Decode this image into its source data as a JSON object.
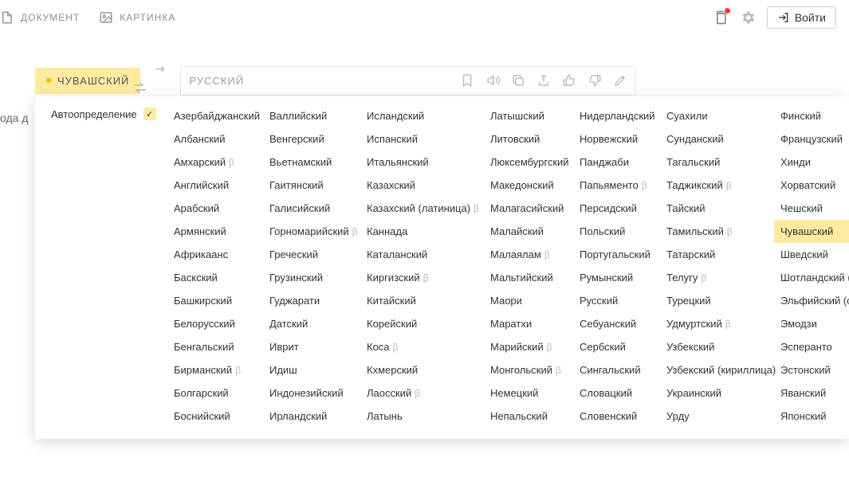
{
  "topbar": {
    "document": "ДОКУМЕНТ",
    "picture": "КАРТИНКА",
    "login": "Войти"
  },
  "langbar": {
    "source": "ЧУВАШСКИЙ",
    "target": "РУССКИЙ"
  },
  "left_hint": "ода д",
  "dropdown": {
    "auto": "Автоопределение",
    "columns": [
      [
        {
          "name": "Азербайджанский",
          "beta": false
        },
        {
          "name": "Албанский",
          "beta": false
        },
        {
          "name": "Амхарский",
          "beta": true
        },
        {
          "name": "Английский",
          "beta": false
        },
        {
          "name": "Арабский",
          "beta": false
        },
        {
          "name": "Армянский",
          "beta": false
        },
        {
          "name": "Африкаанс",
          "beta": false
        },
        {
          "name": "Баскский",
          "beta": false
        },
        {
          "name": "Башкирский",
          "beta": false
        },
        {
          "name": "Белорусский",
          "beta": false
        },
        {
          "name": "Бенгальский",
          "beta": false
        },
        {
          "name": "Бирманский",
          "beta": true
        },
        {
          "name": "Болгарский",
          "beta": false
        },
        {
          "name": "Боснийский",
          "beta": false
        }
      ],
      [
        {
          "name": "Валлийский",
          "beta": false
        },
        {
          "name": "Венгерский",
          "beta": false
        },
        {
          "name": "Вьетнамский",
          "beta": false
        },
        {
          "name": "Гаитянский",
          "beta": false
        },
        {
          "name": "Галисийский",
          "beta": false
        },
        {
          "name": "Горномарийский",
          "beta": true
        },
        {
          "name": "Греческий",
          "beta": false
        },
        {
          "name": "Грузинский",
          "beta": false
        },
        {
          "name": "Гуджарати",
          "beta": false
        },
        {
          "name": "Датский",
          "beta": false
        },
        {
          "name": "Иврит",
          "beta": false
        },
        {
          "name": "Идиш",
          "beta": false
        },
        {
          "name": "Индонезийский",
          "beta": false
        },
        {
          "name": "Ирландский",
          "beta": false
        }
      ],
      [
        {
          "name": "Исландский",
          "beta": false
        },
        {
          "name": "Испанский",
          "beta": false
        },
        {
          "name": "Итальянский",
          "beta": false
        },
        {
          "name": "Казахский",
          "beta": false
        },
        {
          "name": "Казахский (латиница)",
          "beta": true
        },
        {
          "name": "Каннада",
          "beta": false
        },
        {
          "name": "Каталанский",
          "beta": false
        },
        {
          "name": "Киргизский",
          "beta": true
        },
        {
          "name": "Китайский",
          "beta": false
        },
        {
          "name": "Корейский",
          "beta": false
        },
        {
          "name": "Коса",
          "beta": true
        },
        {
          "name": "Кхмерский",
          "beta": false
        },
        {
          "name": "Лаосский",
          "beta": true
        },
        {
          "name": "Латынь",
          "beta": false
        }
      ],
      [
        {
          "name": "Латышский",
          "beta": false
        },
        {
          "name": "Литовский",
          "beta": false
        },
        {
          "name": "Люксембургский",
          "beta": false
        },
        {
          "name": "Македонский",
          "beta": false
        },
        {
          "name": "Малагасийский",
          "beta": false
        },
        {
          "name": "Малайский",
          "beta": false
        },
        {
          "name": "Малаялам",
          "beta": true
        },
        {
          "name": "Мальтийский",
          "beta": false
        },
        {
          "name": "Маори",
          "beta": false
        },
        {
          "name": "Маратхи",
          "beta": false
        },
        {
          "name": "Марийский",
          "beta": true
        },
        {
          "name": "Монгольский",
          "beta": true
        },
        {
          "name": "Немецкий",
          "beta": false
        },
        {
          "name": "Непальский",
          "beta": false
        }
      ],
      [
        {
          "name": "Нидерландский",
          "beta": false
        },
        {
          "name": "Норвежский",
          "beta": false
        },
        {
          "name": "Панджаби",
          "beta": false
        },
        {
          "name": "Папьяменто",
          "beta": true
        },
        {
          "name": "Персидский",
          "beta": false
        },
        {
          "name": "Польский",
          "beta": false
        },
        {
          "name": "Португальский",
          "beta": false
        },
        {
          "name": "Румынский",
          "beta": false
        },
        {
          "name": "Русский",
          "beta": false
        },
        {
          "name": "Себуанский",
          "beta": false
        },
        {
          "name": "Сербский",
          "beta": false
        },
        {
          "name": "Сингальский",
          "beta": false
        },
        {
          "name": "Словацкий",
          "beta": false
        },
        {
          "name": "Словенский",
          "beta": false
        }
      ],
      [
        {
          "name": "Суахили",
          "beta": false
        },
        {
          "name": "Сунданский",
          "beta": false
        },
        {
          "name": "Тагальский",
          "beta": false
        },
        {
          "name": "Таджикский",
          "beta": true
        },
        {
          "name": "Тайский",
          "beta": false
        },
        {
          "name": "Тамильский",
          "beta": true
        },
        {
          "name": "Татарский",
          "beta": false
        },
        {
          "name": "Телугу",
          "beta": true
        },
        {
          "name": "Турецкий",
          "beta": false
        },
        {
          "name": "Удмуртский",
          "beta": true
        },
        {
          "name": "Узбекский",
          "beta": false
        },
        {
          "name": "Узбекский (кириллица)",
          "beta": false
        },
        {
          "name": "Украинский",
          "beta": false
        },
        {
          "name": "Урду",
          "beta": false
        }
      ],
      [
        {
          "name": "Финский",
          "beta": false
        },
        {
          "name": "Французский",
          "beta": false
        },
        {
          "name": "Хинди",
          "beta": false
        },
        {
          "name": "Хорватский",
          "beta": false
        },
        {
          "name": "Чешский",
          "beta": false
        },
        {
          "name": "Чувашский",
          "beta": false,
          "selected": true
        },
        {
          "name": "Шведский",
          "beta": false
        },
        {
          "name": "Шотландский (гэль",
          "beta": false
        },
        {
          "name": "Эльфийский (синд",
          "beta": false
        },
        {
          "name": "Эмодзи",
          "beta": false
        },
        {
          "name": "Эсперанто",
          "beta": false
        },
        {
          "name": "Эстонский",
          "beta": false
        },
        {
          "name": "Яванский",
          "beta": false
        },
        {
          "name": "Японский",
          "beta": false
        }
      ]
    ]
  }
}
